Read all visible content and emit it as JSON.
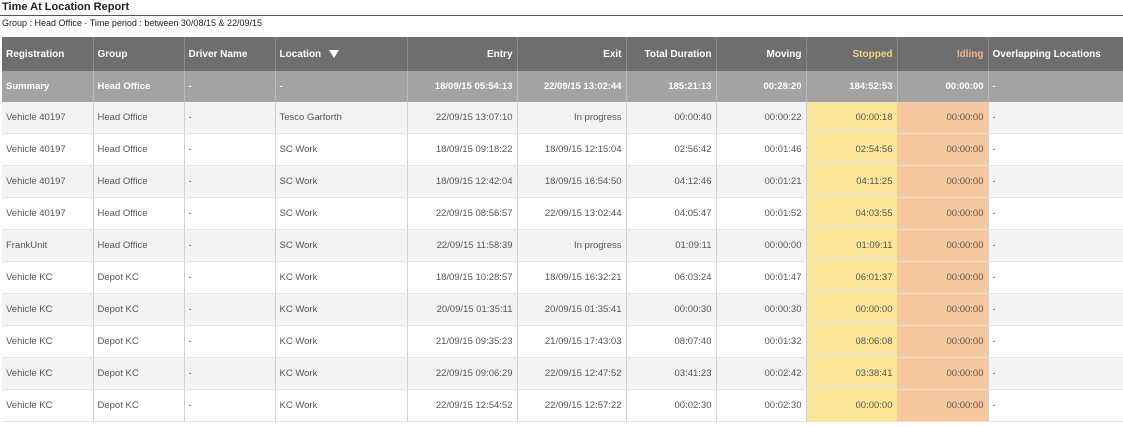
{
  "report": {
    "title": "Time At Location Report",
    "subtitle": "Group : Head Office · Time period : between 30/08/15 & 22/09/15"
  },
  "columns": {
    "registration": "Registration",
    "group": "Group",
    "driver": "Driver Name",
    "location": "Location",
    "entry": "Entry",
    "exit": "Exit",
    "total": "Total Duration",
    "moving": "Moving",
    "stopped": "Stopped",
    "idling": "Idling",
    "overlap": "Overlapping Locations"
  },
  "summary": {
    "registration": "Summary",
    "group": "Head Office",
    "driver": "-",
    "location": "-",
    "entry": "18/09/15 05:54:13",
    "exit": "22/09/15 13:02:44",
    "total": "185:21:13",
    "moving": "00:28:20",
    "stopped": "184:52:53",
    "idling": "00:00:00",
    "overlap": "-"
  },
  "rows": [
    {
      "registration": "Vehicle 40197",
      "group": "Head Office",
      "driver": "-",
      "location": "Tesco Garforth",
      "entry": "22/09/15 13:07:10",
      "exit": "In progress",
      "total": "00:00:40",
      "moving": "00:00:22",
      "stopped": "00:00:18",
      "idling": "00:00:00",
      "overlap": "-"
    },
    {
      "registration": "Vehicle 40197",
      "group": "Head Office",
      "driver": "-",
      "location": "SC Work",
      "entry": "18/09/15 09:18:22",
      "exit": "18/09/15 12:15:04",
      "total": "02:56:42",
      "moving": "00:01:46",
      "stopped": "02:54:56",
      "idling": "00:00:00",
      "overlap": "-"
    },
    {
      "registration": "Vehicle 40197",
      "group": "Head Office",
      "driver": "-",
      "location": "SC Work",
      "entry": "18/09/15 12:42:04",
      "exit": "18/09/15 16:54:50",
      "total": "04:12:46",
      "moving": "00:01:21",
      "stopped": "04:11:25",
      "idling": "00:00:00",
      "overlap": "-"
    },
    {
      "registration": "Vehicle 40197",
      "group": "Head Office",
      "driver": "-",
      "location": "SC Work",
      "entry": "22/09/15 08:56:57",
      "exit": "22/09/15 13:02:44",
      "total": "04:05:47",
      "moving": "00:01:52",
      "stopped": "04:03:55",
      "idling": "00:00:00",
      "overlap": "-"
    },
    {
      "registration": "FrankUnit",
      "group": "Head Office",
      "driver": "-",
      "location": "SC Work",
      "entry": "22/09/15 11:58:39",
      "exit": "In progress",
      "total": "01:09:11",
      "moving": "00:00:00",
      "stopped": "01:09:11",
      "idling": "00:00:00",
      "overlap": "-"
    },
    {
      "registration": "Vehicle KC",
      "group": "Depot KC",
      "driver": "-",
      "location": "KC Work",
      "entry": "18/09/15 10:28:57",
      "exit": "18/09/15 16:32:21",
      "total": "06:03:24",
      "moving": "00:01:47",
      "stopped": "06:01:37",
      "idling": "00:00:00",
      "overlap": "-"
    },
    {
      "registration": "Vehicle KC",
      "group": "Depot KC",
      "driver": "-",
      "location": "KC Work",
      "entry": "20/09/15 01:35:11",
      "exit": "20/09/15 01:35:41",
      "total": "00:00:30",
      "moving": "00:00:30",
      "stopped": "00:00:00",
      "idling": "00:00:00",
      "overlap": "-"
    },
    {
      "registration": "Vehicle KC",
      "group": "Depot KC",
      "driver": "-",
      "location": "KC Work",
      "entry": "21/09/15 09:35:23",
      "exit": "21/09/15 17:43:03",
      "total": "08:07:40",
      "moving": "00:01:32",
      "stopped": "08:06:08",
      "idling": "00:00:00",
      "overlap": "-"
    },
    {
      "registration": "Vehicle KC",
      "group": "Depot KC",
      "driver": "-",
      "location": "KC Work",
      "entry": "22/09/15 09:06:29",
      "exit": "22/09/15 12:47:52",
      "total": "03:41:23",
      "moving": "00:02:42",
      "stopped": "03:38:41",
      "idling": "00:00:00",
      "overlap": "-"
    },
    {
      "registration": "Vehicle KC",
      "group": "Depot KC",
      "driver": "-",
      "location": "KC Work",
      "entry": "22/09/15 12:54:52",
      "exit": "22/09/15 12:57:22",
      "total": "00:02:30",
      "moving": "00:02:30",
      "stopped": "00:00:00",
      "idling": "00:00:00",
      "overlap": "-"
    }
  ]
}
